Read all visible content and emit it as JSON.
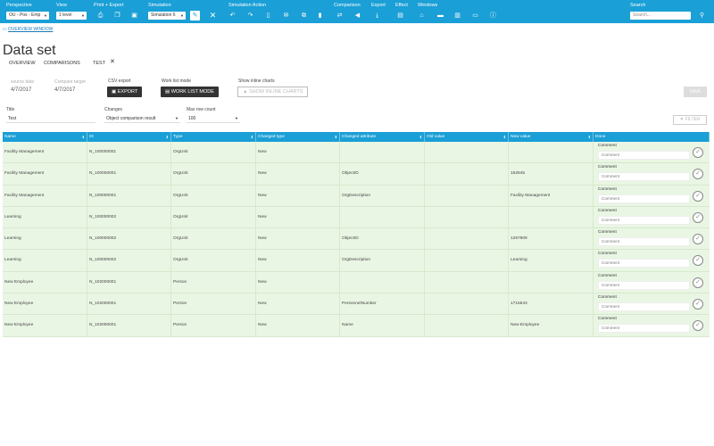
{
  "toolbar": {
    "perspective_label": "Perspective",
    "perspective_value": "OU - Pos - Emp",
    "view_label": "View",
    "view_value": "1 level",
    "print_export_label": "Print + Export",
    "simulation_label": "Simulation",
    "simulation_value": "Simulation 6",
    "simulation_action_label": "Simulation Action",
    "comparison_label": "Comparison",
    "export_label": "Export",
    "effect_label": "Effect",
    "windows_label": "Windows",
    "search_label": "Search",
    "search_placeholder": "Search..."
  },
  "breadcrumb": "OVERVIEW WINDOW",
  "page_title": "Data set",
  "tabs": [
    "OVERVIEW",
    "COMPARISONS",
    "TEST"
  ],
  "source_date_label": "source date",
  "source_date": "4/7/2017",
  "compare_target_label": "Compare target",
  "compare_target": "4/7/2017",
  "csv_export_label": "CSV export",
  "export_button": "EXPORT",
  "work_list_mode_label": "Work list mode",
  "work_list_mode_button": "WORK LIST MODE",
  "show_inline_charts_label": "Show inline charts",
  "show_inline_charts_button": "SHOW INLINE CHARTS",
  "save_button": "SAVE",
  "title_label": "Title",
  "title_value": "Test",
  "changes_label": "Changes",
  "changes_value": "Object comparison result",
  "max_row_count_label": "Max row count",
  "max_row_count_value": "100",
  "filter_button": "FILTER",
  "table": {
    "headers": [
      "Name",
      "ID",
      "Type",
      "Changed type",
      "Changed attribute",
      "Old value",
      "New value",
      "Done"
    ],
    "comment_label": "Comment",
    "comment_placeholder": "Comment",
    "rows": [
      [
        "Facility Management",
        "N_100000001",
        "OrgUnit",
        "New",
        "",
        "",
        ""
      ],
      [
        "Facility Management",
        "N_100000001",
        "OrgUnit",
        "New",
        "ObjectID",
        "",
        "152645"
      ],
      [
        "Facility Management",
        "N_100000001",
        "OrgUnit",
        "New",
        "OrgDescription",
        "",
        "Facility Management"
      ],
      [
        "Learning",
        "N_100000002",
        "OrgUnit",
        "New",
        "",
        "",
        ""
      ],
      [
        "Learning",
        "N_100000002",
        "OrgUnit",
        "New",
        "ObjectID",
        "",
        "1267809"
      ],
      [
        "Learning",
        "N_100000002",
        "OrgUnit",
        "New",
        "OrgDescription",
        "",
        "Learning"
      ],
      [
        "New Employee",
        "N_102000001",
        "Person",
        "New",
        "",
        "",
        ""
      ],
      [
        "New Employee",
        "N_102000001",
        "Person",
        "New",
        "PersonnelNumber",
        "",
        "1715543"
      ],
      [
        "New Employee",
        "N_102000001",
        "Person",
        "New",
        "Name",
        "",
        "New Employee"
      ]
    ]
  },
  "colors": {
    "accent": "#1a9fd6",
    "row_bg": "#eaf6e4"
  }
}
